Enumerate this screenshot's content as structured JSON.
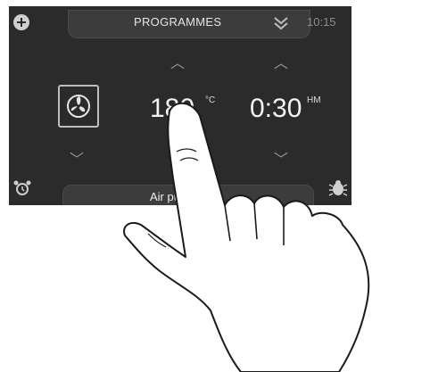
{
  "header": {
    "title": "PROGRAMMES",
    "time": "10:15"
  },
  "controls": {
    "temperature_value": "180",
    "temperature_unit": "°C",
    "duration_value": "0:30",
    "duration_unit": "HM"
  },
  "footer": {
    "mode_label": "Air pulsé"
  },
  "icons": {
    "top_left": "plus-icon",
    "collapse": "double-chevron-down-icon",
    "fan": "fan-icon",
    "bottom_left": "alarm-clock-icon",
    "bottom_right": "bug-icon"
  },
  "colors": {
    "panel": "#2b2b2b",
    "bar": "#3c3c3c",
    "text": "#e5e5e5"
  }
}
